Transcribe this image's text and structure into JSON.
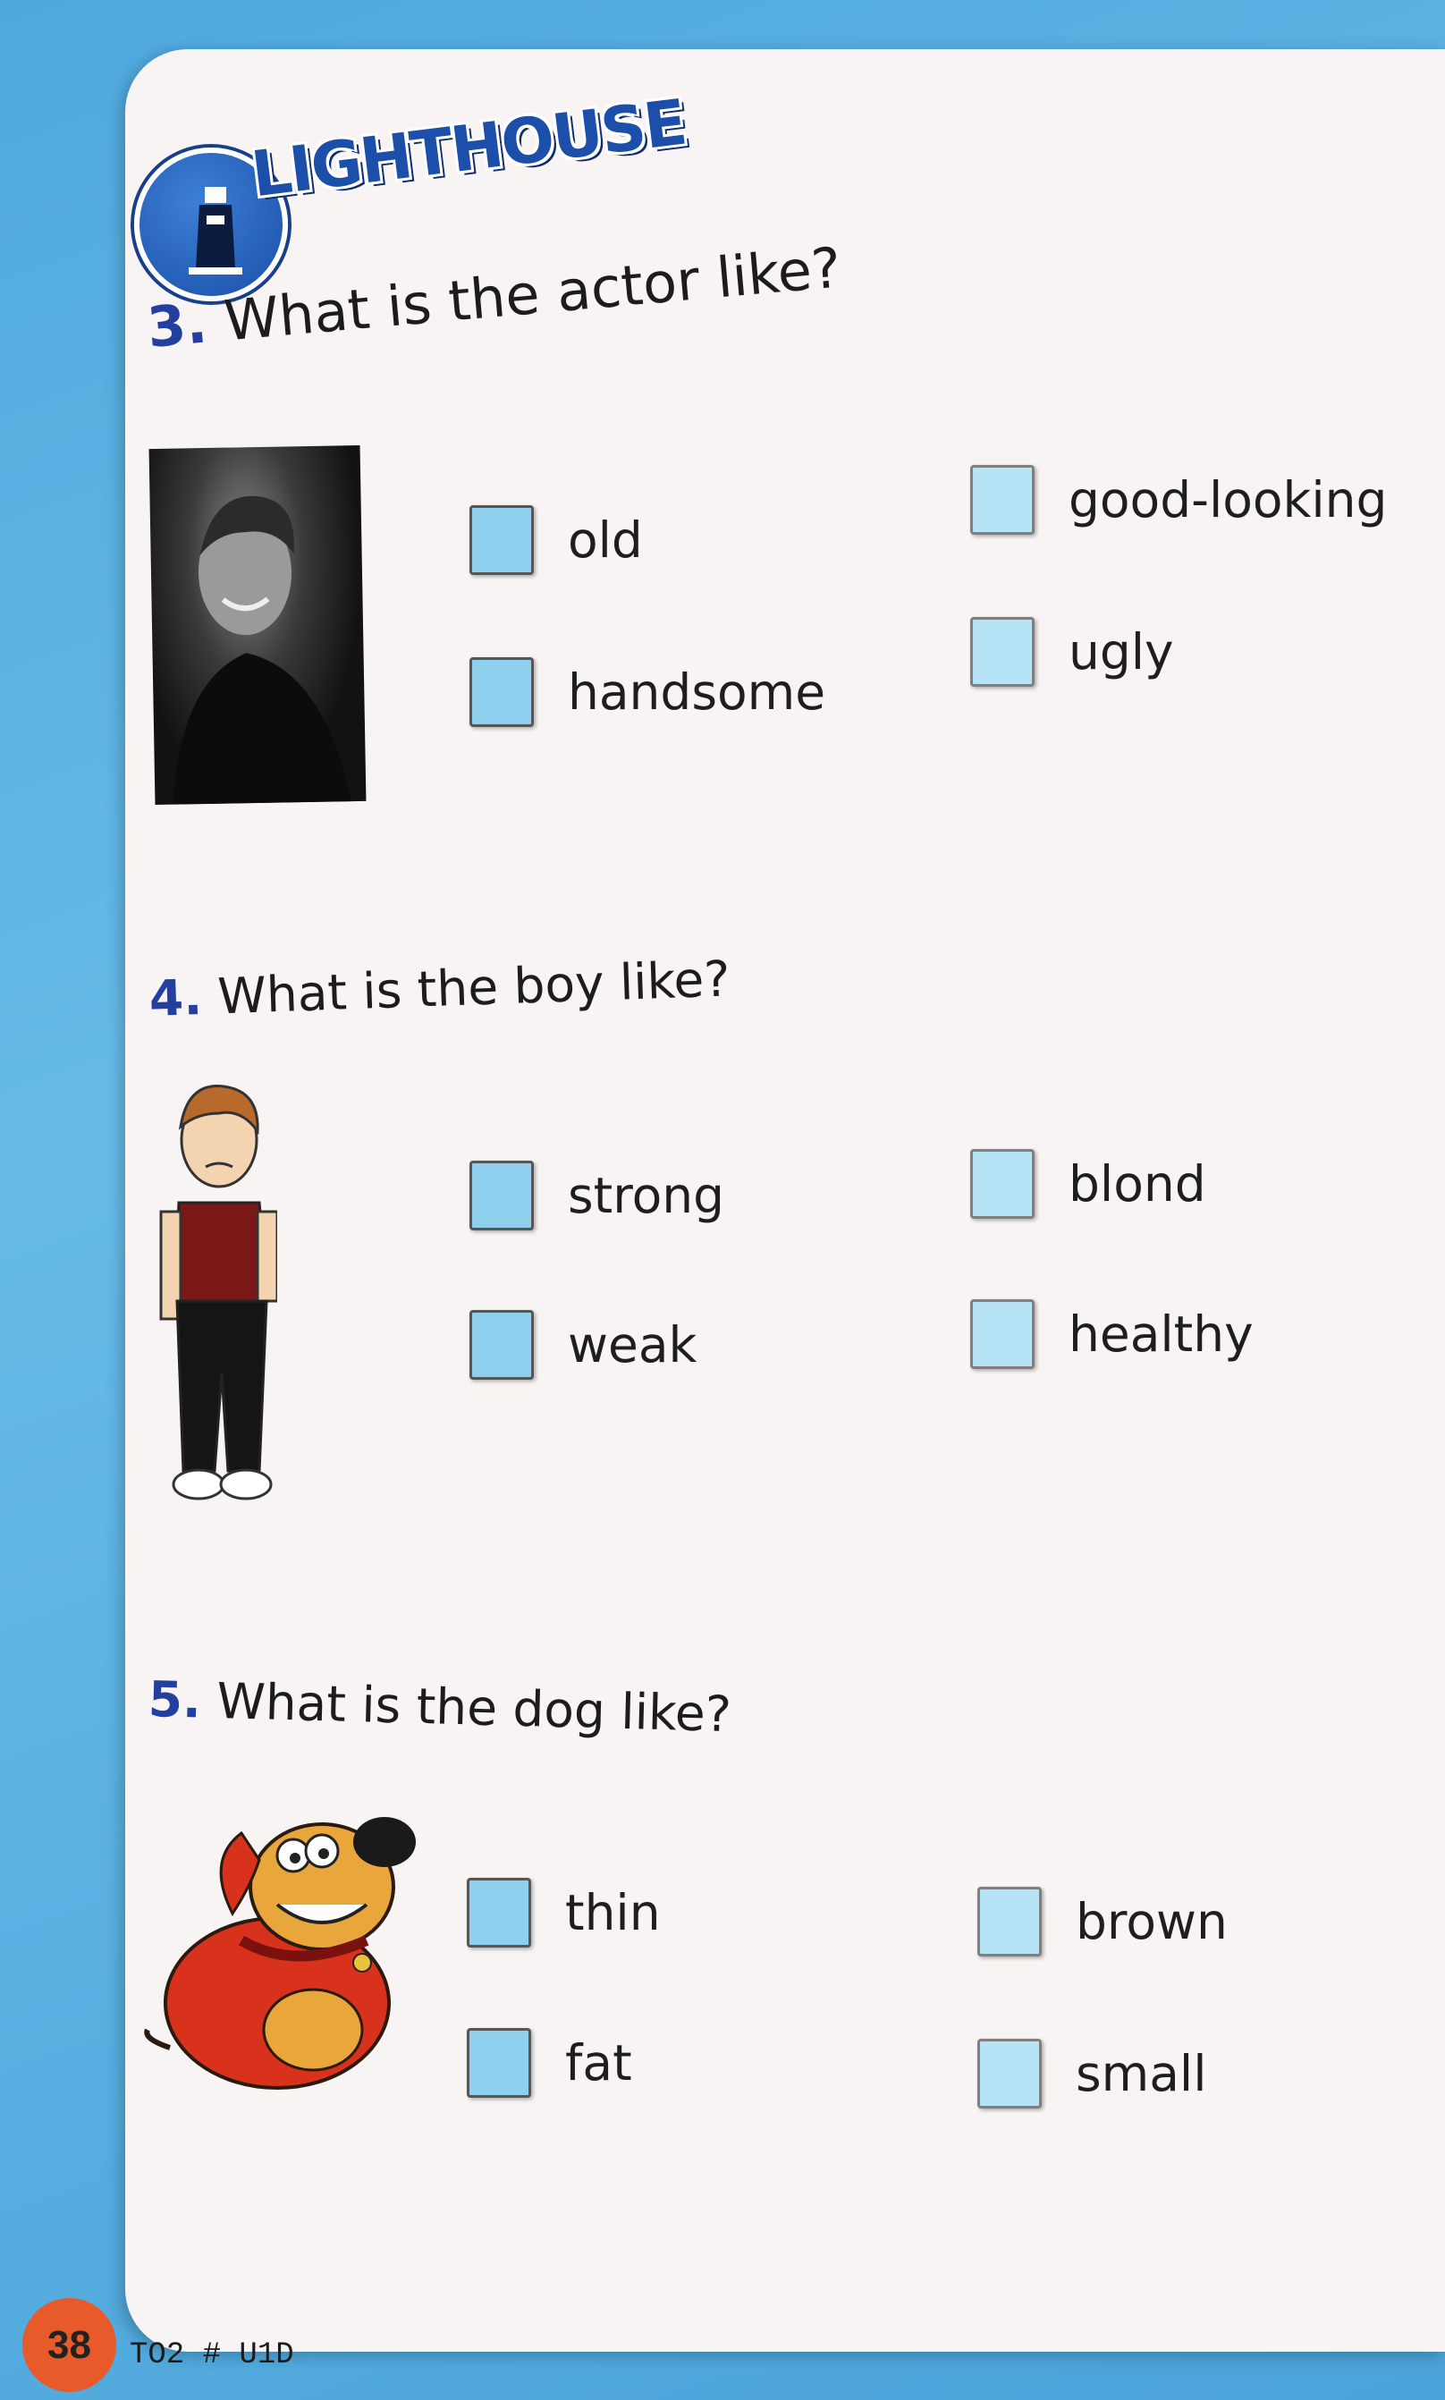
{
  "brand": {
    "logo_text": "LIGHTHOUSE"
  },
  "questions": [
    {
      "number": "3.",
      "text": "What is the actor like?",
      "options": [
        "old",
        "good-looking",
        "handsome",
        "ugly"
      ]
    },
    {
      "number": "4.",
      "text": "What is the boy like?",
      "options": [
        "strong",
        "blond",
        "weak",
        "healthy"
      ]
    },
    {
      "number": "5.",
      "text": "What is the dog like?",
      "options": [
        "thin",
        "brown",
        "fat",
        "small"
      ]
    }
  ],
  "footer": {
    "page_number": "38",
    "code": "TO2 # U1D"
  },
  "colors": {
    "background": "#55aee0",
    "page": "#f8f4f3",
    "checkbox": "#8fd0ee",
    "number": "#233fa0"
  }
}
